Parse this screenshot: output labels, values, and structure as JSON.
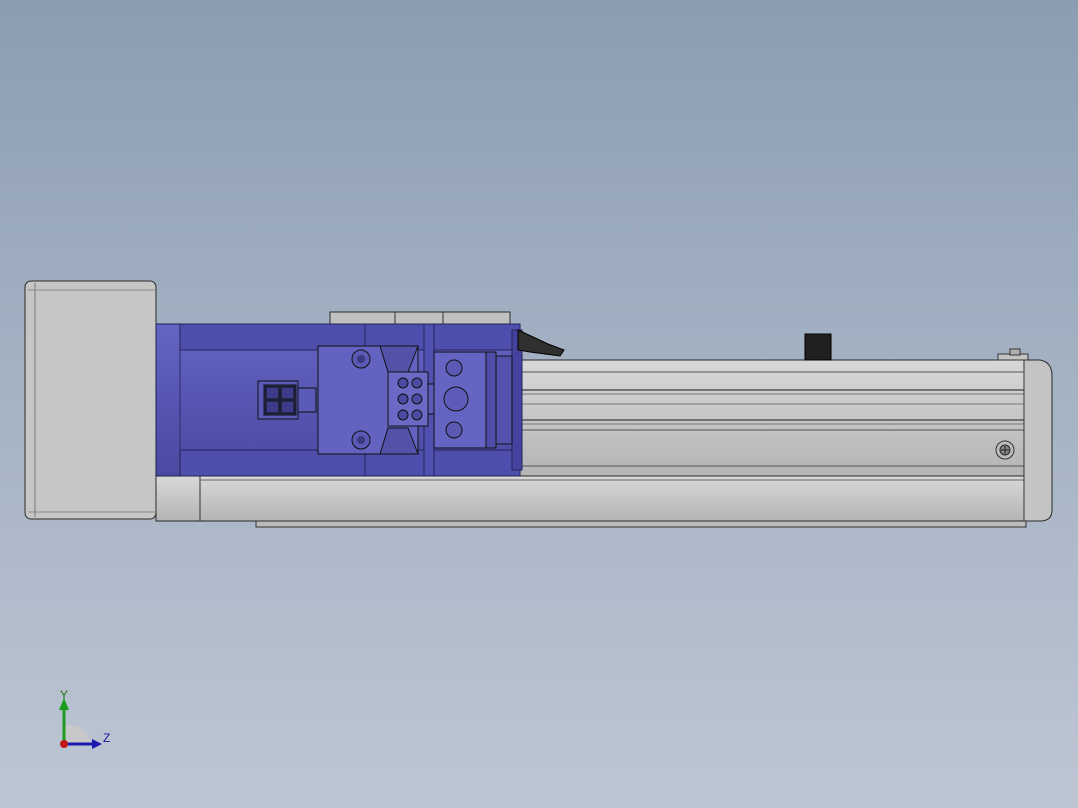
{
  "viewport": {
    "background_top": "#8c9db2",
    "background_bottom": "#bdc6d3"
  },
  "model": {
    "parts": {
      "end_cap_left": "end-cap",
      "motor": "servo-motor",
      "rail": "aluminum-rail",
      "end_cap_right": "end-cap"
    },
    "colors": {
      "motor_body": "#5a5ab8",
      "motor_dark": "#3a3a8c",
      "aluminum": "#c8c8c8",
      "aluminum_dark": "#a6a6a6",
      "edge": "#2a2a2a"
    }
  },
  "triad": {
    "y_label": "Y",
    "z_label": "Z",
    "y_color": "#1e9a1e",
    "z_color": "#1a1ab0",
    "x_color": "#c01818"
  }
}
